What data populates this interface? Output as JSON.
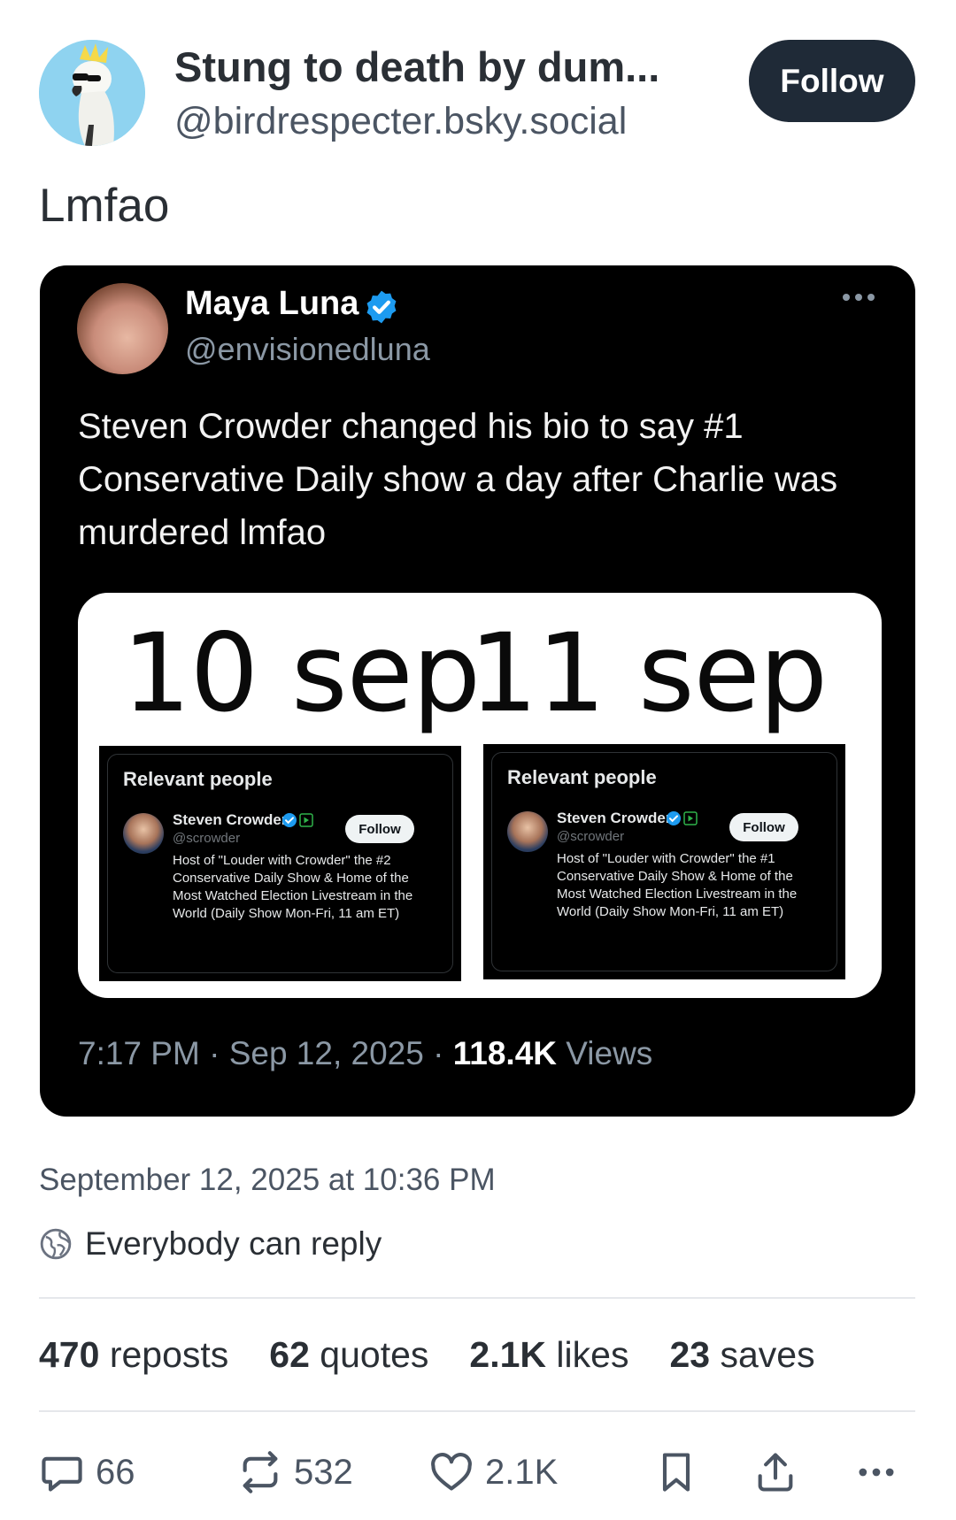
{
  "author": {
    "display_name": "Stung to death by dum...",
    "handle": "@birdrespecter.bsky.social",
    "follow_label": "Follow"
  },
  "post": {
    "text": "Lmfao",
    "timestamp": "September 12, 2025 at 10:36 PM",
    "reply_setting": "Everybody can reply"
  },
  "embedded_post": {
    "name": "Maya Luna",
    "handle": "@envisionedluna",
    "text": "Steven Crowder changed his bio to say #1 Conservative Daily show a day after Charlie was murdered lmfao",
    "time": "7:17 PM",
    "date": "Sep 12, 2025",
    "views_count": "118.4K",
    "views_label": "Views",
    "image": {
      "left_date": "10 sep",
      "right_date": "11 sep",
      "panels": [
        {
          "title": "Relevant people",
          "name": "Steven Crowder",
          "handle": "@scrowder",
          "follow": "Follow",
          "bio": "Host of \"Louder with Crowder\" the #2 Conservative Daily Show & Home of the Most Watched Election Livestream in the World (Daily Show Mon-Fri, 11 am ET)"
        },
        {
          "title": "Relevant people",
          "name": "Steven Crowder",
          "handle": "@scrowder",
          "follow": "Follow",
          "bio": "Host of \"Louder with Crowder\" the #1 Conservative Daily Show & Home of the Most Watched Election Livestream in the World (Daily Show Mon-Fri, 11 am ET)"
        }
      ]
    }
  },
  "stats": {
    "reposts_count": "470",
    "reposts_label": "reposts",
    "quotes_count": "62",
    "quotes_label": "quotes",
    "likes_count": "2.1K",
    "likes_label": "likes",
    "saves_count": "23",
    "saves_label": "saves"
  },
  "actions": {
    "reply_count": "66",
    "repost_count": "532",
    "like_count": "2.1K"
  },
  "colors": {
    "follow_button": "#1f2a37",
    "verified": "#1d9bf0",
    "embed_bg": "#000000"
  },
  "icons": [
    "cockatoo-avatar",
    "verified-badge-icon",
    "more-icon",
    "globe-icon",
    "reply-icon",
    "repost-icon",
    "like-icon",
    "bookmark-icon",
    "share-icon",
    "more-options-icon"
  ]
}
